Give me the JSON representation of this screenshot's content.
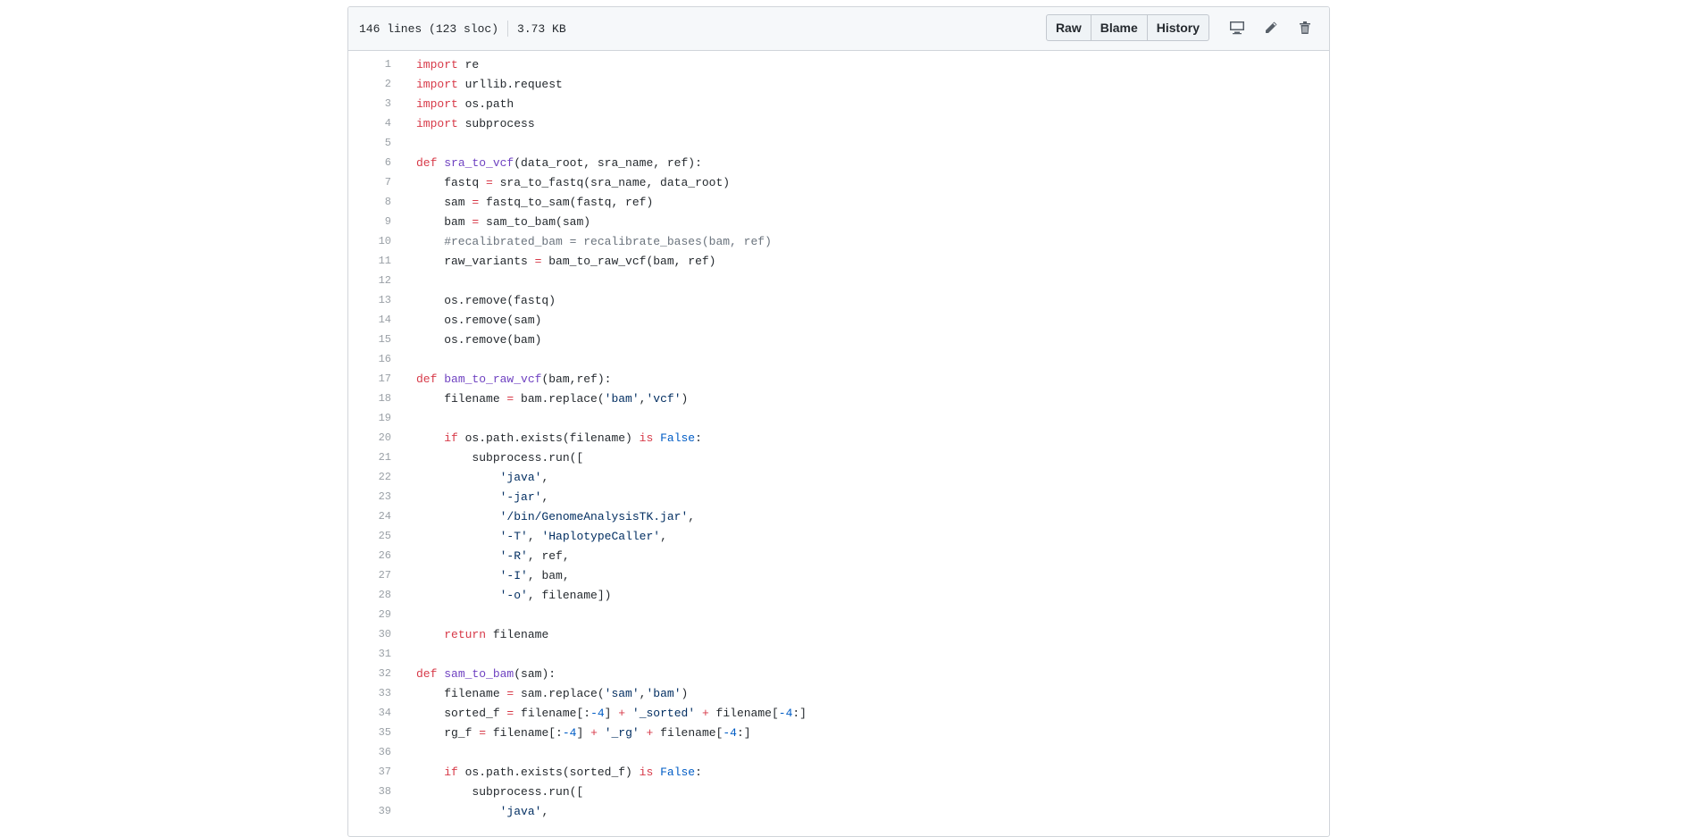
{
  "file_header": {
    "lines_info": "146 lines (123 sloc)",
    "size": "3.73 KB",
    "buttons": {
      "raw": "Raw",
      "blame": "Blame",
      "history": "History"
    },
    "icons": [
      "desktop-icon",
      "pencil-icon",
      "trash-icon"
    ]
  },
  "colors": {
    "keyword": "#d73a49",
    "function": "#6f42c1",
    "string": "#032f62",
    "constant": "#005cc5",
    "comment": "#6a737d",
    "line_number": "#9aa0a6"
  },
  "code_lines": [
    {
      "n": "1",
      "tokens": [
        [
          "kw",
          "import"
        ],
        [
          "t",
          " re"
        ]
      ]
    },
    {
      "n": "2",
      "tokens": [
        [
          "kw",
          "import"
        ],
        [
          "t",
          " urllib.request"
        ]
      ]
    },
    {
      "n": "3",
      "tokens": [
        [
          "kw",
          "import"
        ],
        [
          "t",
          " os.path"
        ]
      ]
    },
    {
      "n": "4",
      "tokens": [
        [
          "kw",
          "import"
        ],
        [
          "t",
          " subprocess"
        ]
      ]
    },
    {
      "n": "5",
      "tokens": []
    },
    {
      "n": "6",
      "tokens": [
        [
          "kw",
          "def"
        ],
        [
          "t",
          " "
        ],
        [
          "fn",
          "sra_to_vcf"
        ],
        [
          "t",
          "(data_root, sra_name, ref):"
        ]
      ]
    },
    {
      "n": "7",
      "tokens": [
        [
          "t",
          "    fastq "
        ],
        [
          "op",
          "="
        ],
        [
          "t",
          " sra_to_fastq(sra_name, data_root)"
        ]
      ]
    },
    {
      "n": "8",
      "tokens": [
        [
          "t",
          "    sam "
        ],
        [
          "op",
          "="
        ],
        [
          "t",
          " fastq_to_sam(fastq, ref)"
        ]
      ]
    },
    {
      "n": "9",
      "tokens": [
        [
          "t",
          "    bam "
        ],
        [
          "op",
          "="
        ],
        [
          "t",
          " sam_to_bam(sam)"
        ]
      ]
    },
    {
      "n": "10",
      "tokens": [
        [
          "cm",
          "    #recalibrated_bam = recalibrate_bases(bam, ref)"
        ]
      ]
    },
    {
      "n": "11",
      "tokens": [
        [
          "t",
          "    raw_variants "
        ],
        [
          "op",
          "="
        ],
        [
          "t",
          " bam_to_raw_vcf(bam, ref)"
        ]
      ]
    },
    {
      "n": "12",
      "tokens": []
    },
    {
      "n": "13",
      "tokens": [
        [
          "t",
          "    os.remove(fastq)"
        ]
      ]
    },
    {
      "n": "14",
      "tokens": [
        [
          "t",
          "    os.remove(sam)"
        ]
      ]
    },
    {
      "n": "15",
      "tokens": [
        [
          "t",
          "    os.remove(bam)"
        ]
      ]
    },
    {
      "n": "16",
      "tokens": []
    },
    {
      "n": "17",
      "tokens": [
        [
          "kw",
          "def"
        ],
        [
          "t",
          " "
        ],
        [
          "fn",
          "bam_to_raw_vcf"
        ],
        [
          "t",
          "(bam,ref):"
        ]
      ]
    },
    {
      "n": "18",
      "tokens": [
        [
          "t",
          "    filename "
        ],
        [
          "op",
          "="
        ],
        [
          "t",
          " bam.replace("
        ],
        [
          "str",
          "'bam'"
        ],
        [
          "t",
          ","
        ],
        [
          "str",
          "'vcf'"
        ],
        [
          "t",
          ")"
        ]
      ]
    },
    {
      "n": "19",
      "tokens": []
    },
    {
      "n": "20",
      "tokens": [
        [
          "t",
          "    "
        ],
        [
          "kw",
          "if"
        ],
        [
          "t",
          " os.path.exists(filename) "
        ],
        [
          "kw",
          "is"
        ],
        [
          "t",
          " "
        ],
        [
          "const",
          "False"
        ],
        [
          "t",
          ":"
        ]
      ]
    },
    {
      "n": "21",
      "tokens": [
        [
          "t",
          "        subprocess.run(["
        ]
      ]
    },
    {
      "n": "22",
      "tokens": [
        [
          "t",
          "            "
        ],
        [
          "str",
          "'java'"
        ],
        [
          "t",
          ","
        ]
      ]
    },
    {
      "n": "23",
      "tokens": [
        [
          "t",
          "            "
        ],
        [
          "str",
          "'-jar'"
        ],
        [
          "t",
          ","
        ]
      ]
    },
    {
      "n": "24",
      "tokens": [
        [
          "t",
          "            "
        ],
        [
          "str",
          "'/bin/GenomeAnalysisTK.jar'"
        ],
        [
          "t",
          ","
        ]
      ]
    },
    {
      "n": "25",
      "tokens": [
        [
          "t",
          "            "
        ],
        [
          "str",
          "'-T'"
        ],
        [
          "t",
          ", "
        ],
        [
          "str",
          "'HaplotypeCaller'"
        ],
        [
          "t",
          ","
        ]
      ]
    },
    {
      "n": "26",
      "tokens": [
        [
          "t",
          "            "
        ],
        [
          "str",
          "'-R'"
        ],
        [
          "t",
          ", ref,"
        ]
      ]
    },
    {
      "n": "27",
      "tokens": [
        [
          "t",
          "            "
        ],
        [
          "str",
          "'-I'"
        ],
        [
          "t",
          ", bam,"
        ]
      ]
    },
    {
      "n": "28",
      "tokens": [
        [
          "t",
          "            "
        ],
        [
          "str",
          "'-o'"
        ],
        [
          "t",
          ", filename])"
        ]
      ]
    },
    {
      "n": "29",
      "tokens": []
    },
    {
      "n": "30",
      "tokens": [
        [
          "t",
          "    "
        ],
        [
          "kw",
          "return"
        ],
        [
          "t",
          " filename"
        ]
      ]
    },
    {
      "n": "31",
      "tokens": []
    },
    {
      "n": "32",
      "tokens": [
        [
          "kw",
          "def"
        ],
        [
          "t",
          " "
        ],
        [
          "fn",
          "sam_to_bam"
        ],
        [
          "t",
          "(sam):"
        ]
      ]
    },
    {
      "n": "33",
      "tokens": [
        [
          "t",
          "    filename "
        ],
        [
          "op",
          "="
        ],
        [
          "t",
          " sam.replace("
        ],
        [
          "str",
          "'sam'"
        ],
        [
          "t",
          ","
        ],
        [
          "str",
          "'bam'"
        ],
        [
          "t",
          ")"
        ]
      ]
    },
    {
      "n": "34",
      "tokens": [
        [
          "t",
          "    sorted_f "
        ],
        [
          "op",
          "="
        ],
        [
          "t",
          " filename[:"
        ],
        [
          "num",
          "-4"
        ],
        [
          "t",
          "] "
        ],
        [
          "op",
          "+"
        ],
        [
          "t",
          " "
        ],
        [
          "str",
          "'_sorted'"
        ],
        [
          "t",
          " "
        ],
        [
          "op",
          "+"
        ],
        [
          "t",
          " filename["
        ],
        [
          "num",
          "-4"
        ],
        [
          "t",
          ":]"
        ]
      ]
    },
    {
      "n": "35",
      "tokens": [
        [
          "t",
          "    rg_f "
        ],
        [
          "op",
          "="
        ],
        [
          "t",
          " filename[:"
        ],
        [
          "num",
          "-4"
        ],
        [
          "t",
          "] "
        ],
        [
          "op",
          "+"
        ],
        [
          "t",
          " "
        ],
        [
          "str",
          "'_rg'"
        ],
        [
          "t",
          " "
        ],
        [
          "op",
          "+"
        ],
        [
          "t",
          " filename["
        ],
        [
          "num",
          "-4"
        ],
        [
          "t",
          ":]"
        ]
      ]
    },
    {
      "n": "36",
      "tokens": []
    },
    {
      "n": "37",
      "tokens": [
        [
          "t",
          "    "
        ],
        [
          "kw",
          "if"
        ],
        [
          "t",
          " os.path.exists(sorted_f) "
        ],
        [
          "kw",
          "is"
        ],
        [
          "t",
          " "
        ],
        [
          "const",
          "False"
        ],
        [
          "t",
          ":"
        ]
      ]
    },
    {
      "n": "38",
      "tokens": [
        [
          "t",
          "        subprocess.run(["
        ]
      ]
    },
    {
      "n": "39",
      "tokens": [
        [
          "t",
          "            "
        ],
        [
          "str",
          "'java'"
        ],
        [
          "t",
          ","
        ]
      ]
    }
  ]
}
